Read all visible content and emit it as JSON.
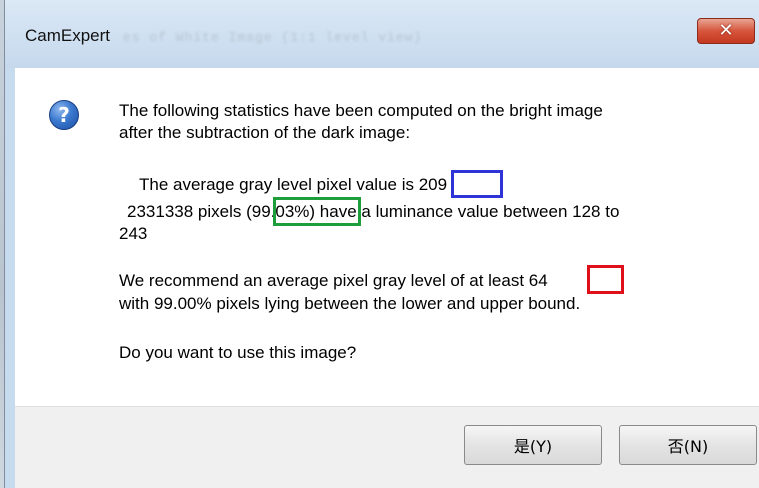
{
  "window": {
    "title": "CamExpert",
    "title_background": "es of White Image (1:1 level view)",
    "close_glyph": "✕"
  },
  "message": {
    "icon": "question-icon",
    "icon_glyph": "?",
    "intro_line1": "The following statistics have been computed on the bright image",
    "intro_line2": "after the subtraction of the dark image:",
    "avg_prefix": "The average gray level pixel value is ",
    "avg_value": "209",
    "pixel_count": "2331338 pixels ",
    "pixel_percent": "(99.03%)",
    "pixel_suffix": " have a luminance value between 128 to",
    "pixel_upper": "243",
    "recommend_prefix": "We recommend an average pixel gray level of at least ",
    "recommend_value": "64",
    "recommend_line2": "with 99.00% pixels lying between the lower and upper bound.",
    "question": "Do you want to use this image?"
  },
  "buttons": {
    "yes_label": "是(Y)",
    "no_label": "否(N)"
  },
  "colors": {
    "highlight_avg": "#2e34d6",
    "highlight_percent": "#1e9e3a",
    "highlight_recommend": "#e0101a",
    "close_button": "#d6553c"
  }
}
